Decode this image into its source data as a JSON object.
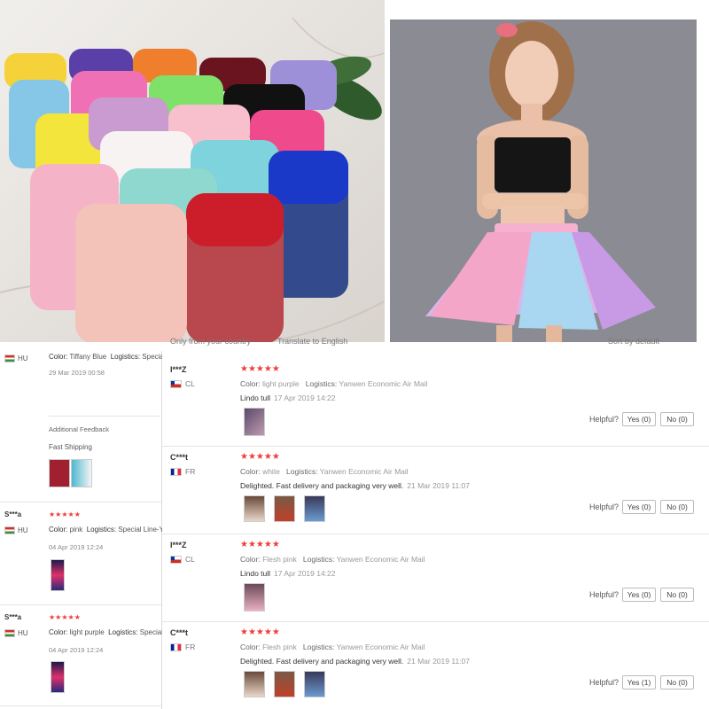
{
  "top_strip": {
    "left_text": "Only from your country",
    "mid_text": "Translate to English",
    "right_text": "Sort by default"
  },
  "left_reviews": [
    {
      "country": "HU",
      "color_label": "Color:",
      "color": "Tiffany Blue",
      "logistics_label": "Logistics:",
      "logistics": "Special Line-YW",
      "date": "29 Mar 2019 00:58",
      "additional_label": "Additional Feedback",
      "additional_text": "Fast Shipping"
    },
    {
      "name": "S***a",
      "country": "HU",
      "color_label": "Color:",
      "color": "pink",
      "logistics_label": "Logistics:",
      "logistics": "Special Line-YW",
      "date": "04 Apr 2019 12:24"
    },
    {
      "name": "S***a",
      "country": "HU",
      "color_label": "Color:",
      "color": "light purple",
      "logistics_label": "Logistics:",
      "logistics": "Special Line-YW",
      "date": "04 Apr 2019 12:24"
    }
  ],
  "reviews": [
    {
      "name": "I***Z",
      "country": "CL",
      "stars": "★★★★★",
      "color_label": "Color:",
      "color": "light purple",
      "logistics_label": "Logistics:",
      "logistics": "Yanwen Economic Air Mail",
      "text": "Lindo tull",
      "date": "17 Apr 2019 14:22",
      "helpful": "Helpful?",
      "yes": "Yes (0)",
      "no": "No (0)"
    },
    {
      "name": "C***t",
      "country": "FR",
      "stars": "★★★★★",
      "color_label": "Color:",
      "color": "white",
      "logistics_label": "Logistics:",
      "logistics": "Yanwen Economic Air Mail",
      "text": "Delighted. Fast delivery and packaging very well.",
      "date": "21 Mar 2019 11:07",
      "helpful": "Helpful?",
      "yes": "Yes (0)",
      "no": "No (0)"
    },
    {
      "name": "I***Z",
      "country": "CL",
      "stars": "★★★★★",
      "color_label": "Color:",
      "color": "Flesh pink",
      "logistics_label": "Logistics:",
      "logistics": "Yanwen Economic Air Mail",
      "text": "Lindo tull",
      "date": "17 Apr 2019 14:22",
      "helpful": "Helpful?",
      "yes": "Yes (0)",
      "no": "No (0)"
    },
    {
      "name": "C***t",
      "country": "FR",
      "stars": "★★★★★",
      "color_label": "Color:",
      "color": "Flesh pink",
      "logistics_label": "Logistics:",
      "logistics": "Yanwen Economic Air Mail",
      "text": "Delighted. Fast delivery and packaging very well.",
      "date": "21 Mar 2019 11:07",
      "helpful": "Helpful?",
      "yes": "Yes (1)",
      "no": "No (0)"
    }
  ],
  "colors": {
    "star": "#f03c3c",
    "accent_text": "#333333"
  }
}
